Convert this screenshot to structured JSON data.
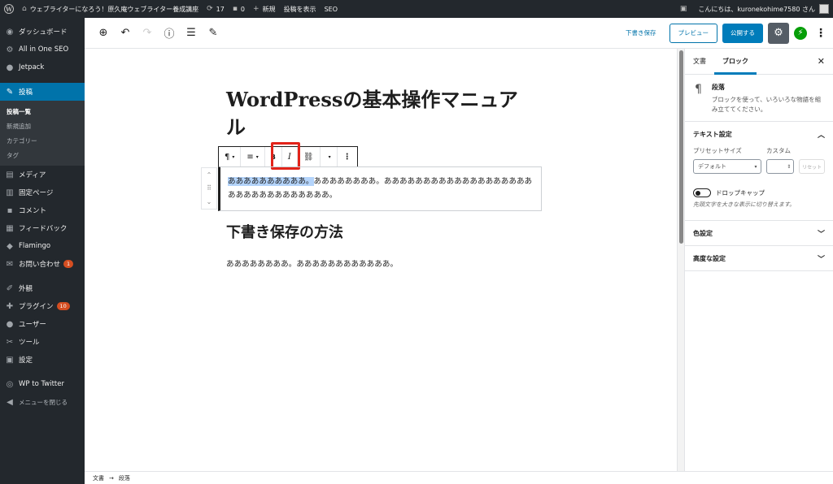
{
  "adminbar": {
    "site_name": "ウェブライターになろう！原久庵ウェブライター養成講座",
    "updates_count": "17",
    "comments_count": "0",
    "new_label": "新規",
    "view_post_label": "投稿を表示",
    "seo_label": "SEO",
    "greeting": "こんにちは、kuronekohime7580 さん"
  },
  "sidebar": {
    "items": [
      {
        "label": "ダッシュボード",
        "icon": "dashboard-icon"
      },
      {
        "label": "All in One SEO",
        "icon": "gear-icon"
      },
      {
        "label": "Jetpack",
        "icon": "jetpack-icon"
      },
      {
        "label": "投稿",
        "icon": "pin-icon"
      },
      {
        "label": "メディア",
        "icon": "media-icon"
      },
      {
        "label": "固定ページ",
        "icon": "page-icon"
      },
      {
        "label": "コメント",
        "icon": "comment-icon"
      },
      {
        "label": "フィードバック",
        "icon": "feedback-icon"
      },
      {
        "label": "Flamingo",
        "icon": "flamingo-icon"
      },
      {
        "label": "お問い合わせ",
        "icon": "mail-icon",
        "badge": "1"
      },
      {
        "label": "外観",
        "icon": "brush-icon"
      },
      {
        "label": "プラグイン",
        "icon": "plugin-icon",
        "badge": "10"
      },
      {
        "label": "ユーザー",
        "icon": "user-icon"
      },
      {
        "label": "ツール",
        "icon": "wrench-icon"
      },
      {
        "label": "設定",
        "icon": "settings-icon"
      },
      {
        "label": "WP to Twitter",
        "icon": "twitter-icon"
      },
      {
        "label": "メニューを閉じる",
        "icon": "collapse-icon"
      }
    ],
    "submenu": [
      "投稿一覧",
      "新規追加",
      "カテゴリー",
      "タグ"
    ]
  },
  "header": {
    "save_draft": "下書き保存",
    "preview": "プレビュー",
    "publish": "公開する"
  },
  "post": {
    "title": "WordPressの基本操作マニュアル",
    "para1_selected": "ああああああああああ。",
    "para1_rest": "ああああああああ。ああああああああああああああああああああああああああああああああ。",
    "heading": "下書き保存の方法",
    "para2": "ああああああああ。ああああああああああああ。"
  },
  "toolbar": {
    "bold": "B",
    "italic": "I"
  },
  "statusbar": {
    "crumb1": "文書",
    "arrow": "→",
    "crumb2": "段落"
  },
  "panel": {
    "tab_document": "文書",
    "tab_block": "ブロック",
    "block_title": "段落",
    "block_desc": "ブロックを使って、いろいろな物語を組み立ててください。",
    "text_settings": "テキスト設定",
    "preset_size_label": "プリセットサイズ",
    "custom_label": "カスタム",
    "preset_value": "デフォルト",
    "reset_label": "リセット",
    "dropcap_label": "ドロップキャップ",
    "dropcap_help": "先頭文字を大きな表示に切り替えます。",
    "color_settings": "色設定",
    "advanced_settings": "高度な設定"
  },
  "colors": {
    "accent": "#007cba",
    "admin_dark": "#23282d",
    "active_menu": "#0073aa",
    "highlight_box": "#e2231a"
  }
}
